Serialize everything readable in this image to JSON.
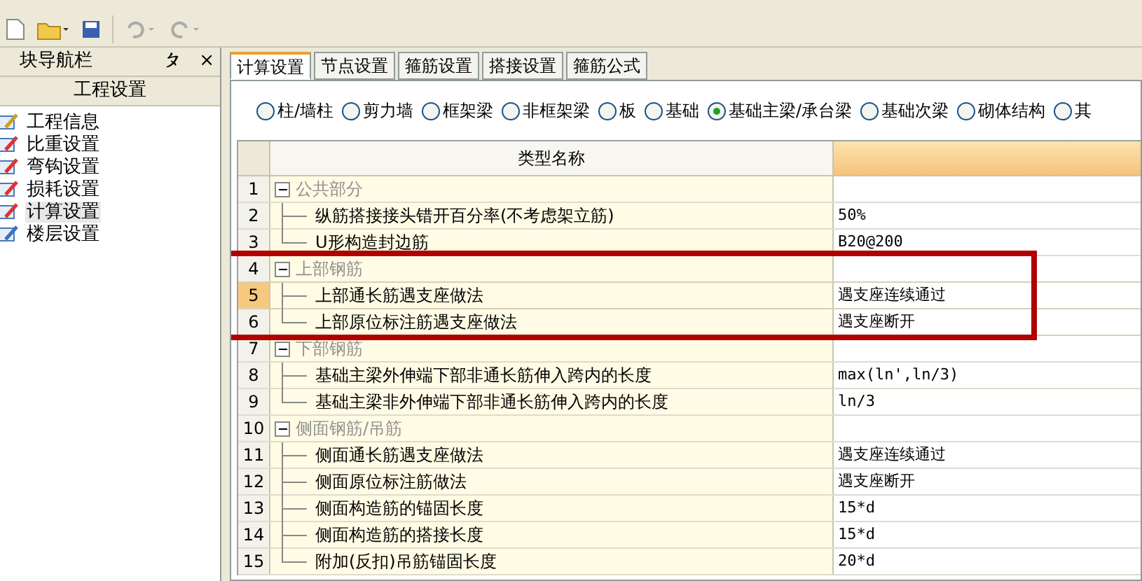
{
  "sidebar": {
    "title": "块导航栏",
    "pin": "ㄆ",
    "close": "×",
    "section": "工程设置",
    "items": [
      {
        "label": "工程信息",
        "selected": false
      },
      {
        "label": "比重设置",
        "selected": false
      },
      {
        "label": "弯钩设置",
        "selected": false
      },
      {
        "label": "损耗设置",
        "selected": false
      },
      {
        "label": "计算设置",
        "selected": true
      },
      {
        "label": "楼层设置",
        "selected": false
      }
    ]
  },
  "tabs": [
    {
      "label": "计算设置",
      "selected": true
    },
    {
      "label": "节点设置",
      "selected": false
    },
    {
      "label": "箍筋设置",
      "selected": false
    },
    {
      "label": "搭接设置",
      "selected": false
    },
    {
      "label": "箍筋公式",
      "selected": false
    }
  ],
  "radios": [
    {
      "label": "柱/墙柱",
      "selected": false
    },
    {
      "label": "剪力墙",
      "selected": false
    },
    {
      "label": "框架梁",
      "selected": false
    },
    {
      "label": "非框架梁",
      "selected": false
    },
    {
      "label": "板",
      "selected": false
    },
    {
      "label": "基础",
      "selected": false
    },
    {
      "label": "基础主梁/承台梁",
      "selected": true
    },
    {
      "label": "基础次梁",
      "selected": false
    },
    {
      "label": "砌体结构",
      "selected": false
    },
    {
      "label": "其",
      "selected": false
    }
  ],
  "table": {
    "columns": [
      "类型名称"
    ],
    "groups": [
      {
        "no": "1",
        "name": "公共部分",
        "expanded": true,
        "highlighted": false,
        "children": [
          {
            "no": "2",
            "name": "纵筋搭接接头错开百分率(不考虑架立筋)",
            "value": "50%",
            "selected": false,
            "highlighted": false
          },
          {
            "no": "3",
            "name": "U形构造封边筋",
            "value": "B20@200",
            "selected": false,
            "highlighted": false
          }
        ]
      },
      {
        "no": "4",
        "name": "上部钢筋",
        "expanded": true,
        "highlighted": true,
        "children": [
          {
            "no": "5",
            "name": "上部通长筋遇支座做法",
            "value": "遇支座连续通过",
            "selected": true,
            "highlighted": true
          },
          {
            "no": "6",
            "name": "上部原位标注筋遇支座做法",
            "value": "遇支座断开",
            "selected": false,
            "highlighted": true
          }
        ]
      },
      {
        "no": "7",
        "name": "下部钢筋",
        "expanded": true,
        "highlighted": false,
        "children": [
          {
            "no": "8",
            "name": "基础主梁外伸端下部非通长筋伸入跨内的长度",
            "value": "max(ln',ln/3)",
            "selected": false,
            "highlighted": false
          },
          {
            "no": "9",
            "name": "基础主梁非外伸端下部非通长筋伸入跨内的长度",
            "value": "ln/3",
            "selected": false,
            "highlighted": false
          }
        ]
      },
      {
        "no": "10",
        "name": "侧面钢筋/吊筋",
        "expanded": true,
        "highlighted": false,
        "children": [
          {
            "no": "11",
            "name": "侧面通长筋遇支座做法",
            "value": "遇支座连续通过",
            "selected": false,
            "highlighted": false
          },
          {
            "no": "12",
            "name": "侧面原位标注筋做法",
            "value": "遇支座断开",
            "selected": false,
            "highlighted": false
          },
          {
            "no": "13",
            "name": "侧面构造筋的锚固长度",
            "value": "15*d",
            "selected": false,
            "highlighted": false
          },
          {
            "no": "14",
            "name": "侧面构造筋的搭接长度",
            "value": "15*d",
            "selected": false,
            "highlighted": false
          },
          {
            "no": "15",
            "name": "附加(反扣)吊筋锚固长度",
            "value": "20*d",
            "selected": false,
            "highlighted": false
          }
        ]
      }
    ]
  }
}
